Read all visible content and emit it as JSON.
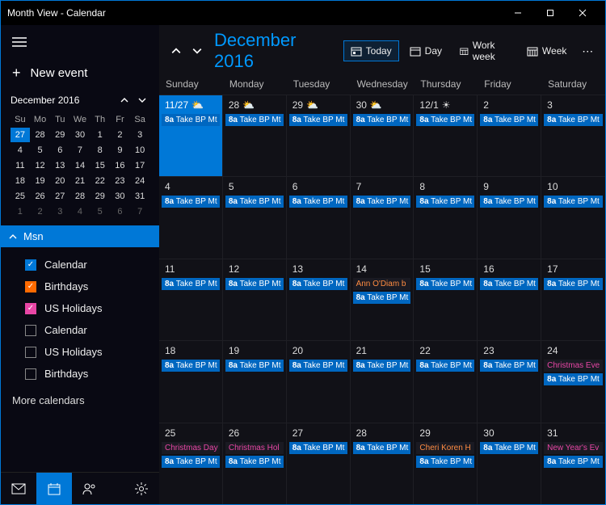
{
  "window": {
    "title": "Month View - Calendar"
  },
  "sidebar": {
    "new_event": "New event",
    "mini_month": "December 2016",
    "dows": [
      "Su",
      "Mo",
      "Tu",
      "We",
      "Th",
      "Fr",
      "Sa"
    ],
    "weeks": [
      [
        {
          "n": "27",
          "sel": true
        },
        {
          "n": "28"
        },
        {
          "n": "29"
        },
        {
          "n": "30"
        },
        {
          "n": "1"
        },
        {
          "n": "2"
        },
        {
          "n": "3"
        }
      ],
      [
        {
          "n": "4"
        },
        {
          "n": "5"
        },
        {
          "n": "6"
        },
        {
          "n": "7"
        },
        {
          "n": "8"
        },
        {
          "n": "9"
        },
        {
          "n": "10"
        }
      ],
      [
        {
          "n": "11"
        },
        {
          "n": "12"
        },
        {
          "n": "13"
        },
        {
          "n": "14"
        },
        {
          "n": "15"
        },
        {
          "n": "16"
        },
        {
          "n": "17"
        }
      ],
      [
        {
          "n": "18"
        },
        {
          "n": "19"
        },
        {
          "n": "20"
        },
        {
          "n": "21"
        },
        {
          "n": "22"
        },
        {
          "n": "23"
        },
        {
          "n": "24"
        }
      ],
      [
        {
          "n": "25"
        },
        {
          "n": "26"
        },
        {
          "n": "27"
        },
        {
          "n": "28"
        },
        {
          "n": "29"
        },
        {
          "n": "30"
        },
        {
          "n": "31"
        }
      ],
      [
        {
          "n": "1",
          "dim": true
        },
        {
          "n": "2",
          "dim": true
        },
        {
          "n": "3",
          "dim": true
        },
        {
          "n": "4",
          "dim": true
        },
        {
          "n": "5",
          "dim": true
        },
        {
          "n": "6",
          "dim": true
        },
        {
          "n": "7",
          "dim": true
        }
      ]
    ],
    "section_label": "Msn",
    "calendars": [
      {
        "label": "Calendar",
        "checked": true,
        "color": "#0078d7"
      },
      {
        "label": "Birthdays",
        "checked": true,
        "color": "#ff6a00"
      },
      {
        "label": "US Holidays",
        "checked": true,
        "color": "#e846a5"
      },
      {
        "label": "Calendar",
        "checked": false,
        "color": "#888"
      },
      {
        "label": "US Holidays",
        "checked": false,
        "color": "#888"
      },
      {
        "label": "Birthdays",
        "checked": false,
        "color": "#888"
      }
    ],
    "more_label": "More calendars"
  },
  "header": {
    "month_title": "December 2016",
    "views": [
      {
        "label": "Today",
        "active": true
      },
      {
        "label": "Day",
        "active": false
      },
      {
        "label": "Work week",
        "active": false
      },
      {
        "label": "Week",
        "active": false
      }
    ]
  },
  "grid": {
    "dows": [
      "Sunday",
      "Monday",
      "Tuesday",
      "Wednesday",
      "Thursday",
      "Friday",
      "Saturday"
    ],
    "weeks": [
      [
        {
          "date": "11/27",
          "today": true,
          "weather": "⛅",
          "events": [
            {
              "t": "8a",
              "txt": "Take BP Mt",
              "c": "blue"
            }
          ]
        },
        {
          "date": "28",
          "weather": "⛅",
          "events": [
            {
              "t": "8a",
              "txt": "Take BP Mt",
              "c": "blue"
            }
          ]
        },
        {
          "date": "29",
          "weather": "⛅",
          "events": [
            {
              "t": "8a",
              "txt": "Take BP Mt",
              "c": "blue"
            }
          ]
        },
        {
          "date": "30",
          "weather": "⛅",
          "events": [
            {
              "t": "8a",
              "txt": "Take BP Mt",
              "c": "blue"
            }
          ]
        },
        {
          "date": "12/1",
          "weather": "☀",
          "events": [
            {
              "t": "8a",
              "txt": "Take BP Mt",
              "c": "blue"
            }
          ]
        },
        {
          "date": "2",
          "events": [
            {
              "t": "8a",
              "txt": "Take BP Mt",
              "c": "blue"
            }
          ]
        },
        {
          "date": "3",
          "events": [
            {
              "t": "8a",
              "txt": "Take BP Mt",
              "c": "blue"
            }
          ]
        }
      ],
      [
        {
          "date": "4",
          "events": [
            {
              "t": "8a",
              "txt": "Take BP Mt",
              "c": "blue"
            }
          ]
        },
        {
          "date": "5",
          "events": [
            {
              "t": "8a",
              "txt": "Take BP Mt",
              "c": "blue"
            }
          ]
        },
        {
          "date": "6",
          "events": [
            {
              "t": "8a",
              "txt": "Take BP Mt",
              "c": "blue"
            }
          ]
        },
        {
          "date": "7",
          "events": [
            {
              "t": "8a",
              "txt": "Take BP Mt",
              "c": "blue"
            }
          ]
        },
        {
          "date": "8",
          "events": [
            {
              "t": "8a",
              "txt": "Take BP Mt",
              "c": "blue"
            }
          ]
        },
        {
          "date": "9",
          "events": [
            {
              "t": "8a",
              "txt": "Take BP Mt",
              "c": "blue"
            }
          ]
        },
        {
          "date": "10",
          "events": [
            {
              "t": "8a",
              "txt": "Take BP Mt",
              "c": "blue"
            }
          ]
        }
      ],
      [
        {
          "date": "11",
          "events": [
            {
              "t": "8a",
              "txt": "Take BP Mt",
              "c": "blue"
            }
          ]
        },
        {
          "date": "12",
          "events": [
            {
              "t": "8a",
              "txt": "Take BP Mt",
              "c": "blue"
            }
          ]
        },
        {
          "date": "13",
          "events": [
            {
              "t": "8a",
              "txt": "Take BP Mt",
              "c": "blue"
            }
          ]
        },
        {
          "date": "14",
          "events": [
            {
              "t": "",
              "txt": "Ann O'Diam b",
              "c": "orange"
            },
            {
              "t": "8a",
              "txt": "Take BP Mt",
              "c": "blue"
            }
          ]
        },
        {
          "date": "15",
          "events": [
            {
              "t": "8a",
              "txt": "Take BP Mt",
              "c": "blue"
            }
          ]
        },
        {
          "date": "16",
          "events": [
            {
              "t": "8a",
              "txt": "Take BP Mt",
              "c": "blue"
            }
          ]
        },
        {
          "date": "17",
          "events": [
            {
              "t": "8a",
              "txt": "Take BP Mt",
              "c": "blue"
            }
          ]
        }
      ],
      [
        {
          "date": "18",
          "events": [
            {
              "t": "8a",
              "txt": "Take BP Mt",
              "c": "blue"
            }
          ]
        },
        {
          "date": "19",
          "events": [
            {
              "t": "8a",
              "txt": "Take BP Mt",
              "c": "blue"
            }
          ]
        },
        {
          "date": "20",
          "events": [
            {
              "t": "8a",
              "txt": "Take BP Mt",
              "c": "blue"
            }
          ]
        },
        {
          "date": "21",
          "events": [
            {
              "t": "8a",
              "txt": "Take BP Mt",
              "c": "blue"
            }
          ]
        },
        {
          "date": "22",
          "events": [
            {
              "t": "8a",
              "txt": "Take BP Mt",
              "c": "blue"
            }
          ]
        },
        {
          "date": "23",
          "events": [
            {
              "t": "8a",
              "txt": "Take BP Mt",
              "c": "blue"
            }
          ]
        },
        {
          "date": "24",
          "events": [
            {
              "t": "",
              "txt": "Christmas Eve",
              "c": "pink"
            },
            {
              "t": "8a",
              "txt": "Take BP Mt",
              "c": "blue"
            }
          ]
        }
      ],
      [
        {
          "date": "25",
          "events": [
            {
              "t": "",
              "txt": "Christmas Day",
              "c": "pink"
            },
            {
              "t": "8a",
              "txt": "Take BP Mt",
              "c": "blue"
            }
          ]
        },
        {
          "date": "26",
          "events": [
            {
              "t": "",
              "txt": "Christmas Hol",
              "c": "pink"
            },
            {
              "t": "8a",
              "txt": "Take BP Mt",
              "c": "blue"
            }
          ]
        },
        {
          "date": "27",
          "events": [
            {
              "t": "8a",
              "txt": "Take BP Mt",
              "c": "blue"
            }
          ]
        },
        {
          "date": "28",
          "events": [
            {
              "t": "8a",
              "txt": "Take BP Mt",
              "c": "blue"
            }
          ]
        },
        {
          "date": "29",
          "events": [
            {
              "t": "",
              "txt": "Cheri Koren H",
              "c": "orange"
            },
            {
              "t": "8a",
              "txt": "Take BP Mt",
              "c": "blue"
            }
          ]
        },
        {
          "date": "30",
          "events": [
            {
              "t": "8a",
              "txt": "Take BP Mt",
              "c": "blue"
            }
          ]
        },
        {
          "date": "31",
          "events": [
            {
              "t": "",
              "txt": "New Year's Ev",
              "c": "pink"
            },
            {
              "t": "8a",
              "txt": "Take BP Mt",
              "c": "blue"
            }
          ]
        }
      ]
    ]
  }
}
